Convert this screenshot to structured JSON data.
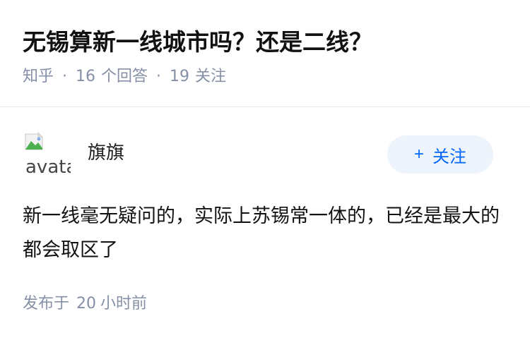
{
  "question": {
    "title": "无锡算新一线城市吗？还是二线？",
    "source": "知乎",
    "separator": "·",
    "answer_count": "16",
    "answer_label": "个回答",
    "follower_count": "19",
    "follower_label": "关注"
  },
  "answer": {
    "avatar_alt": "avatar",
    "author_name": "旗旗",
    "follow_button": {
      "icon": "+",
      "label": "关注"
    },
    "content": "新一线毫无疑问的，实际上苏锡常一体的，已经是最大的都会取区了",
    "time_prefix": "发布于",
    "time_value": "20",
    "time_suffix": "小时前"
  },
  "colors": {
    "accent": "#0066ff",
    "follow_bg": "#eef4fc",
    "meta_text": "#8590a6"
  }
}
